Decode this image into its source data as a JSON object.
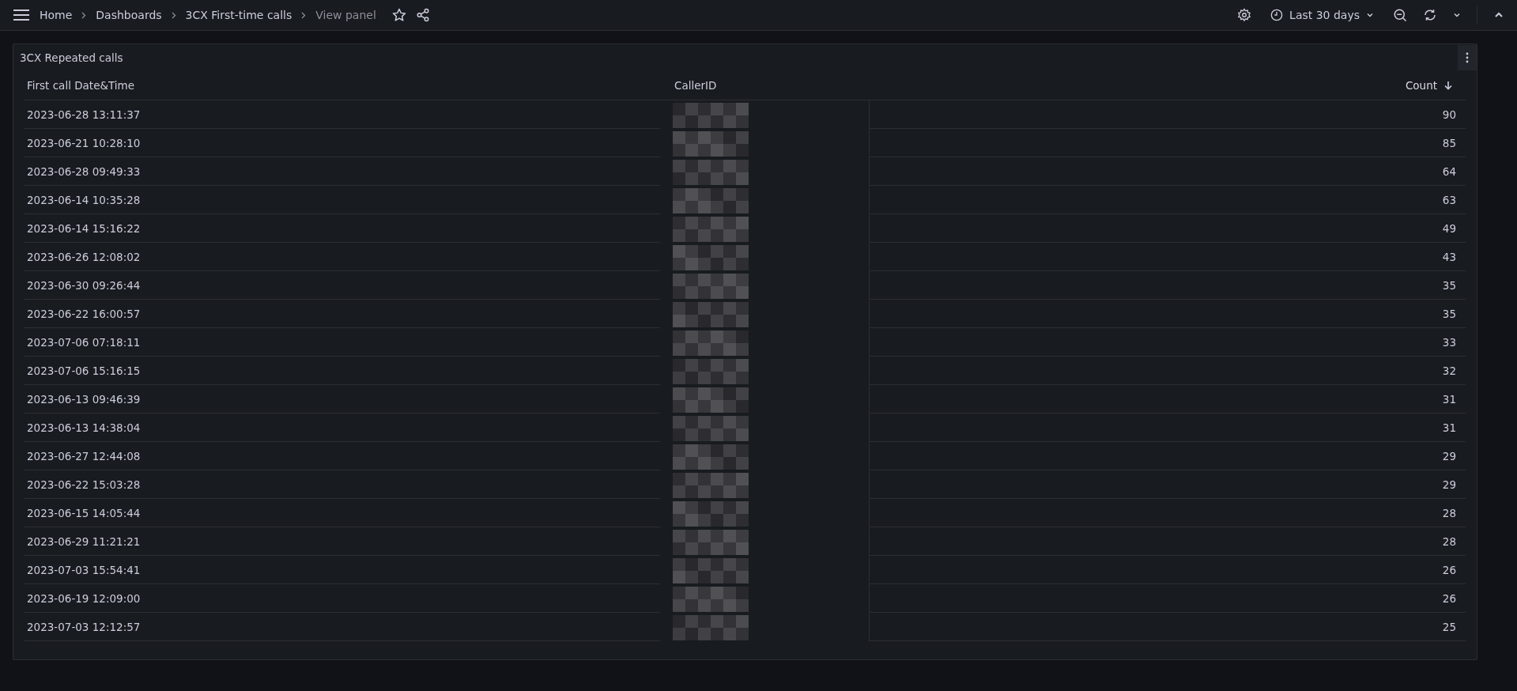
{
  "breadcrumbs": [
    {
      "label": "Home",
      "current": false
    },
    {
      "label": "Dashboards",
      "current": false
    },
    {
      "label": "3CX First-time calls",
      "current": false
    },
    {
      "label": "View panel",
      "current": true
    }
  ],
  "time_range": {
    "label": "Last 30 days"
  },
  "panel": {
    "title": "3CX Repeated calls"
  },
  "table": {
    "columns": [
      {
        "label": "First call Date&Time",
        "sorted": false
      },
      {
        "label": "CallerID",
        "sorted": false
      },
      {
        "label": "Count",
        "sorted": true
      }
    ],
    "rows": [
      {
        "time": "2023-06-28 13:11:37",
        "count": "90"
      },
      {
        "time": "2023-06-21 10:28:10",
        "count": "85"
      },
      {
        "time": "2023-06-28 09:49:33",
        "count": "64"
      },
      {
        "time": "2023-06-14 10:35:28",
        "count": "63"
      },
      {
        "time": "2023-06-14 15:16:22",
        "count": "49"
      },
      {
        "time": "2023-06-26 12:08:02",
        "count": "43"
      },
      {
        "time": "2023-06-30 09:26:44",
        "count": "35"
      },
      {
        "time": "2023-06-22 16:00:57",
        "count": "35"
      },
      {
        "time": "2023-07-06 07:18:11",
        "count": "33"
      },
      {
        "time": "2023-07-06 15:16:15",
        "count": "32"
      },
      {
        "time": "2023-06-13 09:46:39",
        "count": "31"
      },
      {
        "time": "2023-06-13 14:38:04",
        "count": "31"
      },
      {
        "time": "2023-06-27 12:44:08",
        "count": "29"
      },
      {
        "time": "2023-06-22 15:03:28",
        "count": "29"
      },
      {
        "time": "2023-06-15 14:05:44",
        "count": "28"
      },
      {
        "time": "2023-06-29 11:21:21",
        "count": "28"
      },
      {
        "time": "2023-07-03 15:54:41",
        "count": "26"
      },
      {
        "time": "2023-06-19 12:09:00",
        "count": "26"
      },
      {
        "time": "2023-07-03 12:12:57",
        "count": "25"
      }
    ]
  }
}
